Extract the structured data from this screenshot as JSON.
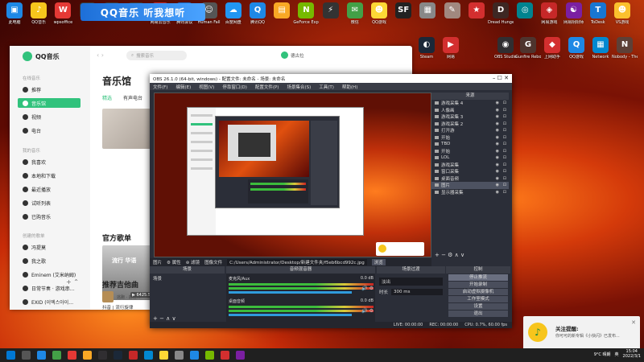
{
  "desktop": {
    "icons_row1": [
      {
        "label": "此电脑",
        "color": "#1e88e5",
        "glyph": "▣"
      },
      {
        "label": "QQ音乐",
        "color": "#f7c51c",
        "glyph": "♪"
      },
      {
        "label": "wpsoffice",
        "color": "#e53935",
        "glyph": "W"
      },
      {
        "label": "",
        "color": "#3a3a3a",
        "glyph": ""
      },
      {
        "label": "",
        "color": "#3a3a3a",
        "glyph": ""
      },
      {
        "label": "",
        "color": "#3a3a3a",
        "glyph": ""
      },
      {
        "label": "网易云音乐",
        "color": "#c62828",
        "glyph": "◉"
      },
      {
        "label": "腾讯会议",
        "color": "#1565c0",
        "glyph": "◆"
      },
      {
        "label": "Human Fall",
        "color": "#555",
        "glyph": "☺"
      },
      {
        "label": "百度网盘",
        "color": "#2196f3",
        "glyph": "☁"
      },
      {
        "label": "腾讯QQ",
        "color": "#1e88e5",
        "glyph": "Q"
      },
      {
        "label": "",
        "color": "#f9a825",
        "glyph": "▤"
      },
      {
        "label": "GeForce Experience",
        "color": "#76b900",
        "glyph": "N"
      },
      {
        "label": "",
        "color": "#333",
        "glyph": "⚡"
      },
      {
        "label": "微信",
        "color": "#43a047",
        "glyph": "✉"
      },
      {
        "label": "QQ游戏",
        "color": "#fdd835",
        "glyph": "☻"
      },
      {
        "label": "",
        "color": "#222",
        "glyph": "SF"
      },
      {
        "label": "",
        "color": "#888",
        "glyph": "▦"
      },
      {
        "label": "",
        "color": "#a1887f",
        "glyph": "✎"
      },
      {
        "label": "",
        "color": "#d32f2f",
        "glyph": "★"
      },
      {
        "label": "Dread Hunger",
        "color": "#3e2723",
        "glyph": "D"
      },
      {
        "label": "",
        "color": "#00838f",
        "glyph": "◎"
      },
      {
        "label": "网易游戏",
        "color": "#c62828",
        "glyph": "◈"
      },
      {
        "label": "网易阴阳师",
        "color": "#7b1fa2",
        "glyph": "☯"
      },
      {
        "label": "ToDesk",
        "color": "#1976d2",
        "glyph": "T"
      },
      {
        "label": "VS游戏",
        "color": "#fbc02d",
        "glyph": "☻"
      }
    ],
    "icons_row2": [
      {
        "label": "Steam",
        "color": "#1b2838",
        "glyph": "◐"
      },
      {
        "label": "网易",
        "color": "#d32f2f",
        "glyph": "▶"
      },
      {
        "label": "OBS Studio",
        "color": "#302e31",
        "glyph": "◉"
      },
      {
        "label": "Gunfire Reborn",
        "color": "#4e342e",
        "glyph": "G"
      },
      {
        "label": "上网助手",
        "color": "#d32f2f",
        "glyph": "◆"
      },
      {
        "label": "QQ游戏",
        "color": "#1e88e5",
        "glyph": "Q"
      },
      {
        "label": "Network",
        "color": "#0288d1",
        "glyph": "▦"
      },
      {
        "label": "Nobody - The Turna",
        "color": "#5d4037",
        "glyph": "N"
      }
    ],
    "banner_text": "QQ音乐 听我想听"
  },
  "qqmusic": {
    "logo": "QQ音乐",
    "nav_arrows": "‹ ›",
    "search_placeholder": "搜索音乐",
    "user_name": "德古拉",
    "section_online": "在线音乐",
    "online_items": [
      {
        "label": "推荐",
        "active": false
      },
      {
        "label": "音乐馆",
        "active": true
      },
      {
        "label": "视频",
        "active": false
      },
      {
        "label": "电台",
        "active": false
      }
    ],
    "section_mine": "我的音乐",
    "mine_items": [
      "我喜欢",
      "本地和下载",
      "最近播放",
      "试听列表",
      "已购音乐"
    ],
    "section_created": "创建的歌单",
    "playlists": [
      "冯提莫",
      "我之歌",
      "Eminem (艾米纳姆)",
      "日常节奏 · 游戏串…",
      "EXID (이엑스아이…"
    ],
    "page_title": "音乐馆",
    "tabs": [
      {
        "label": "精选",
        "on": true
      },
      {
        "label": "有声电台",
        "on": false
      }
    ],
    "section_playlist": "官方歌单",
    "card_title": "流行 华语",
    "card_count": "▶ 6425.5万",
    "card_caption": "抖音 | 流行旋律",
    "section_recommend": "推荐吉他曲",
    "footer_song": "逃跑 · 前往..."
  },
  "obs": {
    "title": "OBS 26.1.0 (64-bit, windows) - 配置文件: 未命名 - 场景: 未命名",
    "menu": [
      "文件(F)",
      "编辑(E)",
      "视图(V)",
      "停靠窗口(D)",
      "配置文件(P)",
      "场景集合(S)",
      "工具(T)",
      "帮助(H)"
    ],
    "sources_header": "来源",
    "sources": [
      {
        "label": "游戏采集 4",
        "sel": false
      },
      {
        "label": "人像画",
        "sel": false
      },
      {
        "label": "游戏采集 3",
        "sel": false
      },
      {
        "label": "游戏采集 2",
        "sel": false
      },
      {
        "label": "打开游",
        "sel": false
      },
      {
        "label": "开始",
        "sel": false
      },
      {
        "label": "TBD",
        "sel": false
      },
      {
        "label": "开始",
        "sel": false
      },
      {
        "label": "LOL",
        "sel": false
      },
      {
        "label": "游戏采集",
        "sel": false
      },
      {
        "label": "窗口采集",
        "sel": false
      },
      {
        "label": "桌面音频",
        "sel": false
      },
      {
        "label": "图片",
        "sel": true
      },
      {
        "label": "显示器采集",
        "sel": false
      }
    ],
    "source_tools": "+ − ⚙ ∧ ∨",
    "props_label": "图片",
    "props_prop": "⚙ 属性",
    "props_filter": "⊛ 滤镜",
    "props_file": "图像文件",
    "props_path": "C:/Users/Administrator/Desktop/新建文件夹/f5eb6bcd992c.jpg",
    "props_browse": "浏览",
    "dock_scenes": "场景",
    "dock_mixer": "音频混音器",
    "dock_trans": "场景过渡",
    "dock_controls": "控制",
    "scene_item": "场景",
    "scene_tools": "+ − ∧ ∨",
    "mixer": [
      {
        "name": "麦克风/Aux",
        "db": "0.0 dB"
      },
      {
        "name": "桌面音频",
        "db": "0.0 dB"
      }
    ],
    "mixer_ctl": "🔊 ⚙",
    "trans_fade": "淡出",
    "trans_dur_label": "时长",
    "trans_dur": "300 ms",
    "controls": [
      {
        "label": "停止推流",
        "on": true
      },
      {
        "label": "开始录制",
        "on": false
      },
      {
        "label": "启动虚拟摄像机",
        "on": false
      },
      {
        "label": "工作室模式",
        "on": false
      },
      {
        "label": "设置",
        "on": false
      },
      {
        "label": "退出",
        "on": false
      }
    ],
    "status": [
      "LIVE: 00:00:00",
      "REC: 00:00:00",
      "CPU: 0.7%, 60.00 fps"
    ],
    "titlebar_controls": "– ☐ ✕"
  },
  "notification": {
    "title": "关注提醒:",
    "message": "你可可的新专辑《小快闪》已发布...",
    "close": "✕"
  },
  "taskbar": {
    "items": [
      "#0078d4",
      "#555",
      "#1e88e5",
      "#43a047",
      "#e53935",
      "#f9a825",
      "#302e31",
      "#1b2838",
      "#c62828",
      "#0288d1",
      "#fdd835",
      "#888",
      "#1e88e5",
      "#76b900",
      "#d32f2f",
      "#7b1fa2"
    ],
    "weather": "9°C 晴朗",
    "lang": "英",
    "time": "15:04",
    "date": "2022/3/1"
  }
}
